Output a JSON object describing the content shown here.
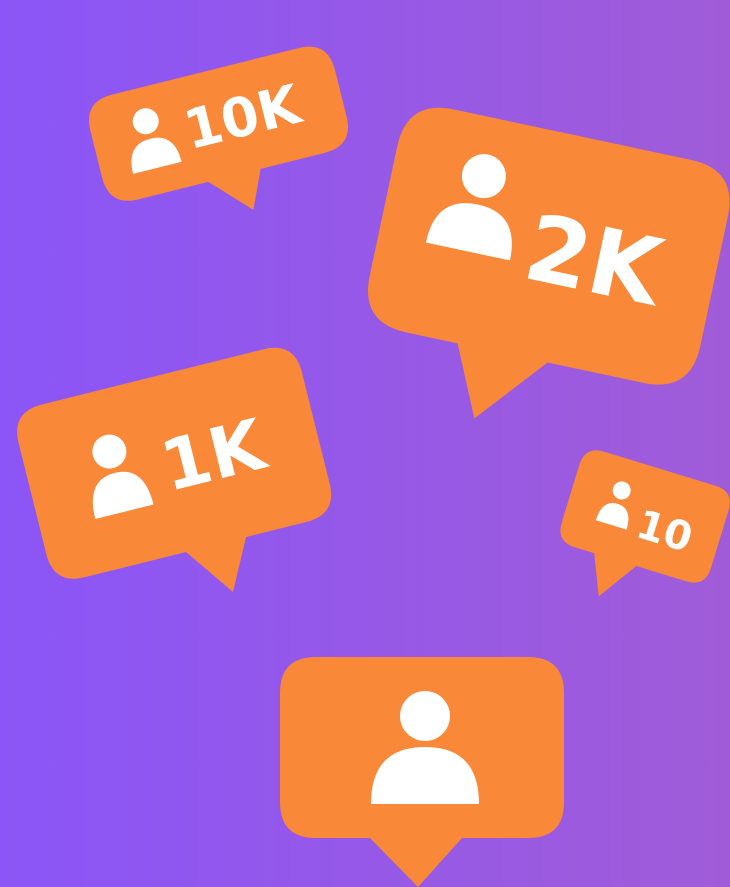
{
  "background": {
    "gradient_start": "#8B55F7",
    "gradient_end": "#A05CD8"
  },
  "badge_color": "#F98838",
  "icon_color": "#FFFFFF",
  "icon": "user-icon",
  "badges": [
    {
      "count": "10K"
    },
    {
      "count": "2K"
    },
    {
      "count": "1K"
    },
    {
      "count": "10"
    },
    {
      "count": ""
    }
  ]
}
